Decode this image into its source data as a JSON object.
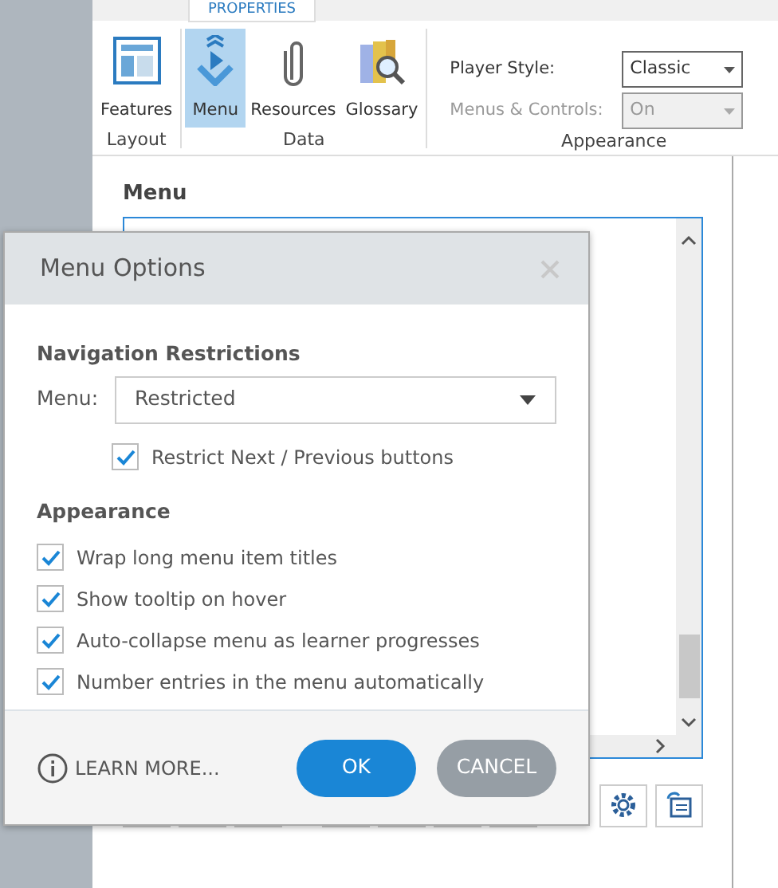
{
  "ribbon": {
    "tab": {
      "label": "PROPERTIES",
      "selected": true
    },
    "groups": [
      {
        "label": "Layout",
        "items": [
          {
            "label": "Features",
            "kind": "layout",
            "selected": false
          }
        ]
      },
      {
        "label": "Data",
        "items": [
          {
            "label": "Menu",
            "kind": "menu",
            "selected": true
          },
          {
            "label": "Resources",
            "kind": "clip",
            "selected": false
          },
          {
            "label": "Glossary",
            "kind": "books",
            "selected": false
          }
        ]
      }
    ],
    "appearance": {
      "label": "Appearance",
      "fields": [
        {
          "label": "Player Style:",
          "value": "Classic",
          "disabled": false
        },
        {
          "label": "Menus & Controls:",
          "value": "On",
          "disabled": true
        }
      ]
    }
  },
  "panel": {
    "title": "Menu"
  },
  "dialog": {
    "title": "Menu Options",
    "navigation": {
      "heading": "Navigation Restrictions",
      "field_label": "Menu:",
      "value": "Restricted",
      "restrict": {
        "label": "Restrict Next / Previous buttons",
        "checked": true
      }
    },
    "appearance": {
      "heading": "Appearance",
      "options": [
        {
          "label": "Wrap long menu item titles",
          "checked": true
        },
        {
          "label": "Show tooltip on hover",
          "checked": true
        },
        {
          "label": "Auto-collapse menu as learner progresses",
          "checked": true
        },
        {
          "label": "Number entries in the menu automatically",
          "checked": true
        }
      ]
    },
    "learn_more": "LEARN MORE...",
    "ok": "OK",
    "cancel": "CANCEL"
  }
}
